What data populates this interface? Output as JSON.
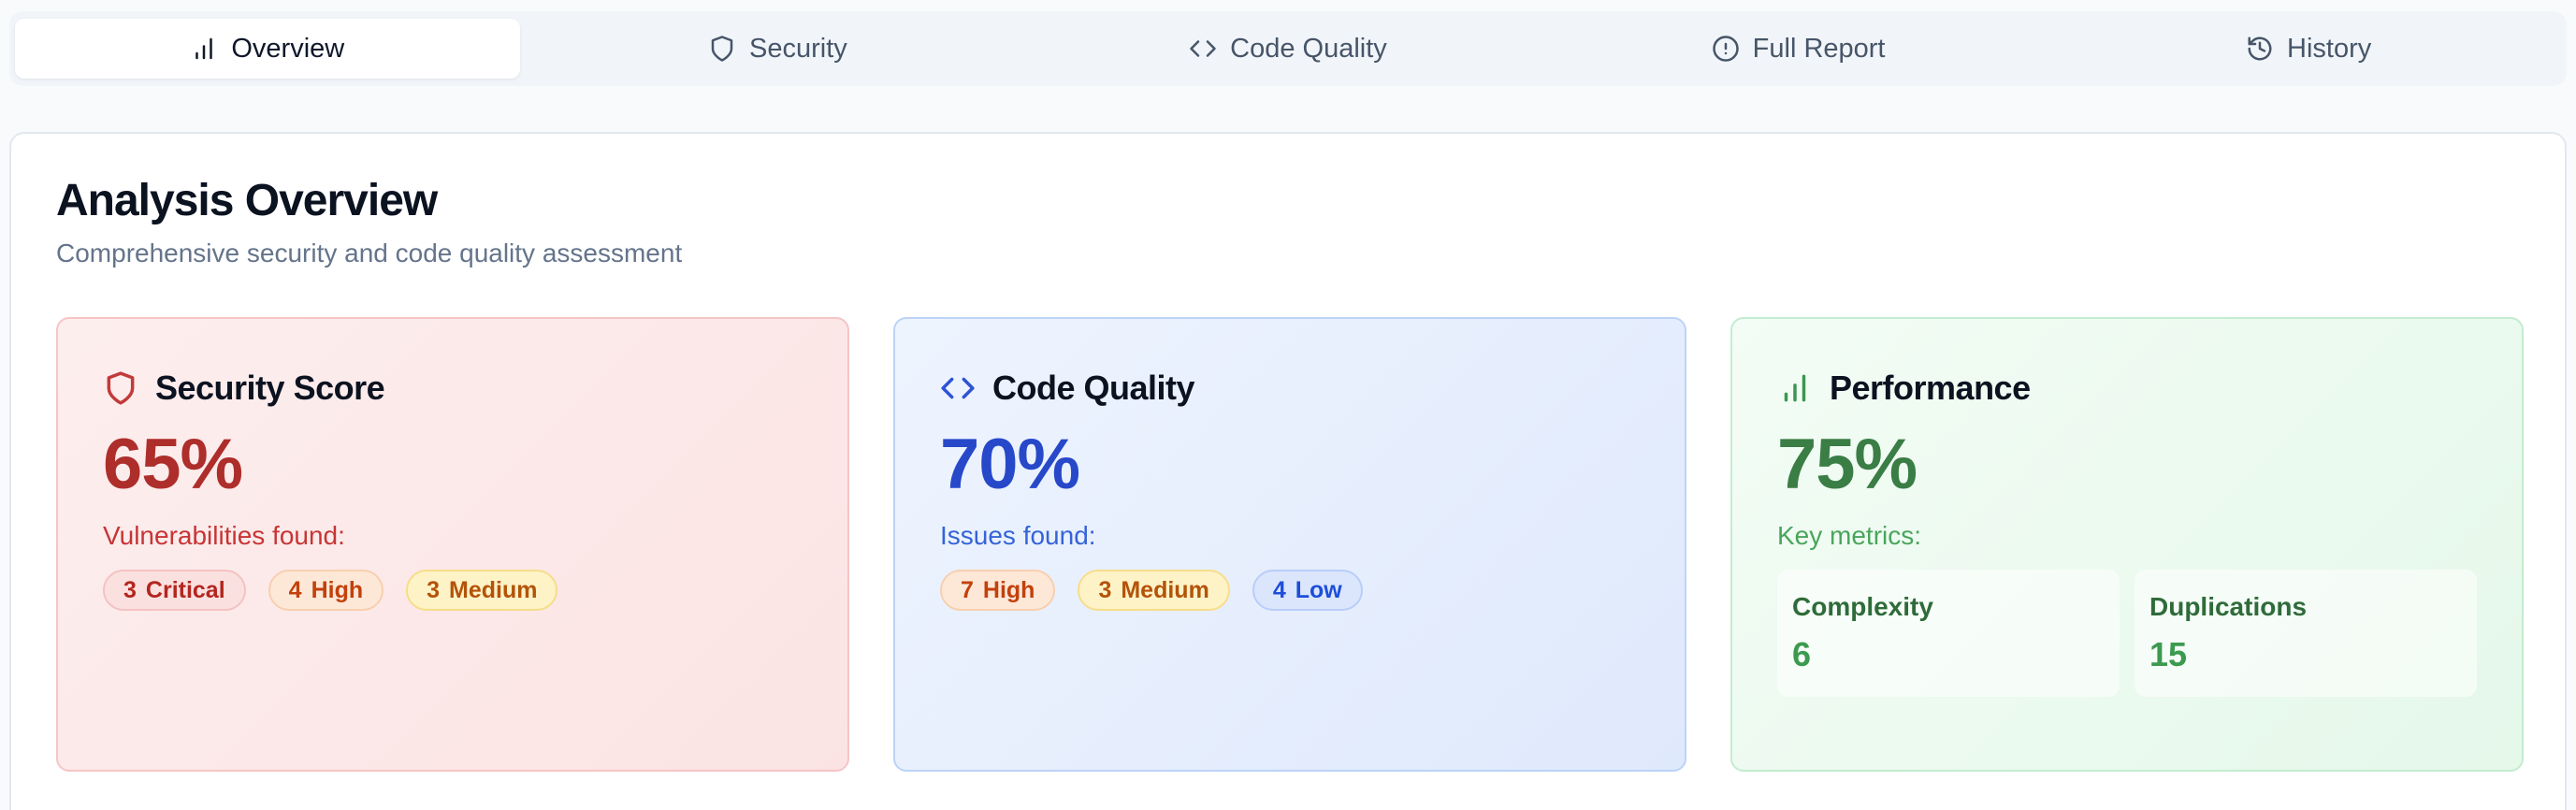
{
  "tabs": [
    {
      "label": "Overview",
      "icon": "bar-chart-icon"
    },
    {
      "label": "Security",
      "icon": "shield-icon"
    },
    {
      "label": "Code Quality",
      "icon": "code-icon"
    },
    {
      "label": "Full Report",
      "icon": "alert-circle-icon"
    },
    {
      "label": "History",
      "icon": "history-icon"
    }
  ],
  "overview": {
    "title": "Analysis Overview",
    "subtitle": "Comprehensive security and code quality assessment"
  },
  "security": {
    "title": "Security Score",
    "score": "65%",
    "label": "Vulnerabilities found:",
    "badges": [
      {
        "count": "3",
        "level": "Critical"
      },
      {
        "count": "4",
        "level": "High"
      },
      {
        "count": "3",
        "level": "Medium"
      }
    ]
  },
  "code_quality": {
    "title": "Code Quality",
    "score": "70%",
    "label": "Issues found:",
    "badges": [
      {
        "count": "7",
        "level": "High"
      },
      {
        "count": "3",
        "level": "Medium"
      },
      {
        "count": "4",
        "level": "Low"
      }
    ]
  },
  "performance": {
    "title": "Performance",
    "score": "75%",
    "label": "Key metrics:",
    "metrics": [
      {
        "name": "Complexity",
        "value": "6"
      },
      {
        "name": "Duplications",
        "value": "15"
      }
    ]
  },
  "colors": {
    "security_accent": "#ad2e2a",
    "code_quality_accent": "#2748c9",
    "performance_accent": "#3a7d45"
  }
}
